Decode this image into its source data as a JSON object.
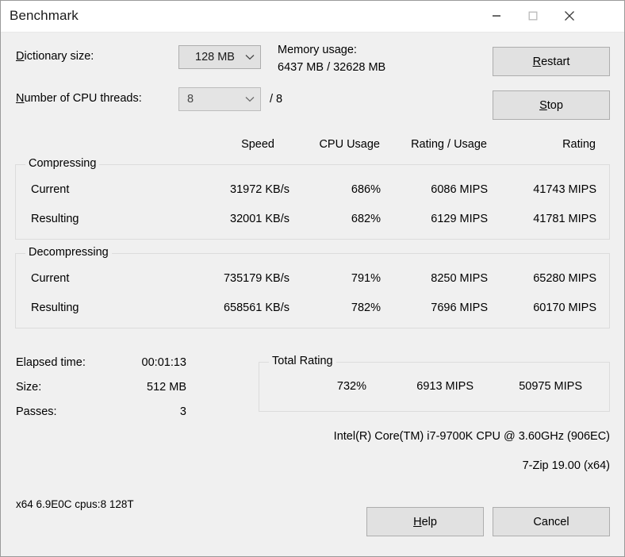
{
  "window": {
    "title": "Benchmark",
    "controls": {
      "minimize": "minimize-icon",
      "maximize": "maximize-icon",
      "close": "close-icon"
    }
  },
  "settings": {
    "dictionary_label": "Dictionary size:",
    "dictionary_accel": "D",
    "dictionary_rest": "ictionary size:",
    "dictionary_value": "128 MB",
    "threads_label": "Number of CPU threads:",
    "threads_accel": "N",
    "threads_rest": "umber of CPU threads:",
    "threads_value": "8",
    "threads_total": "/ 8",
    "memory_label": "Memory usage:",
    "memory_value": "6437 MB / 32628 MB"
  },
  "buttons": {
    "restart_accel": "R",
    "restart_rest": "estart",
    "stop_accel": "S",
    "stop_rest": "top",
    "help_accel": "H",
    "help_rest": "elp",
    "cancel": "Cancel"
  },
  "table": {
    "headers": {
      "speed": "Speed",
      "cpu_usage": "CPU Usage",
      "rating_usage": "Rating / Usage",
      "rating": "Rating"
    },
    "compressing": {
      "title": "Compressing",
      "rows": [
        {
          "label": "Current",
          "speed": "31972 KB/s",
          "cpu_usage": "686%",
          "rating_usage": "6086 MIPS",
          "rating": "41743 MIPS"
        },
        {
          "label": "Resulting",
          "speed": "32001 KB/s",
          "cpu_usage": "682%",
          "rating_usage": "6129 MIPS",
          "rating": "41781 MIPS"
        }
      ]
    },
    "decompressing": {
      "title": "Decompressing",
      "rows": [
        {
          "label": "Current",
          "speed": "735179 KB/s",
          "cpu_usage": "791%",
          "rating_usage": "8250 MIPS",
          "rating": "65280 MIPS"
        },
        {
          "label": "Resulting",
          "speed": "658561 KB/s",
          "cpu_usage": "782%",
          "rating_usage": "7696 MIPS",
          "rating": "60170 MIPS"
        }
      ]
    }
  },
  "stats": {
    "elapsed_label": "Elapsed time:",
    "elapsed_value": "00:01:13",
    "size_label": "Size:",
    "size_value": "512 MB",
    "passes_label": "Passes:",
    "passes_value": "3"
  },
  "total_rating": {
    "title": "Total Rating",
    "cpu_usage": "732%",
    "rating_usage": "6913 MIPS",
    "rating": "50975 MIPS"
  },
  "footer": {
    "cpu_info": "Intel(R) Core(TM) i7-9700K CPU @ 3.60GHz (906EC)",
    "version": "7-Zip 19.00 (x64)",
    "status": "x64 6.9E0C cpus:8 128T"
  }
}
